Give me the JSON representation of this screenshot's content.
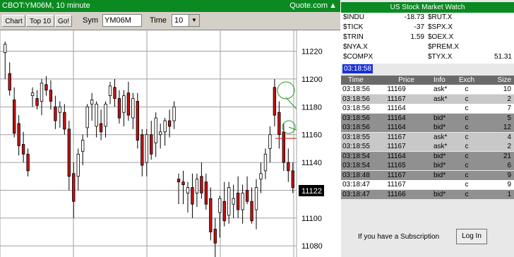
{
  "chart_panel": {
    "title": "CBOT:YM06M, 10 minute",
    "brand": "Quote.com",
    "caret": "▲",
    "toolbar": {
      "chart_btn": "Chart",
      "top10_btn": "Top 10",
      "go_btn": "Go!",
      "sym_label": "Sym",
      "sym_value": "YM06M",
      "time_label": "Time",
      "time_value": "10"
    },
    "y_ticks": [
      "11220",
      "11200",
      "11180",
      "11160",
      "11140",
      "11122",
      "11100",
      "11080"
    ],
    "last_price": "11122"
  },
  "chart_data": {
    "type": "candlestick",
    "y_axis": {
      "min": 11072,
      "max": 11235,
      "ticks": [
        11220,
        11200,
        11180,
        11160,
        11140,
        11120,
        11100,
        11080
      ]
    },
    "grid": true,
    "last_price_marker": 11122,
    "colors": {
      "up": "#ffffff",
      "down": "#c81010",
      "grid": "#a0a0a0"
    },
    "candles": [
      [
        11219,
        11227,
        11200,
        11225
      ],
      [
        11204,
        11212,
        11188,
        11192
      ],
      [
        11185,
        11194,
        11158,
        11161
      ],
      [
        11168,
        11174,
        11145,
        11152
      ],
      [
        11153,
        11162,
        11140,
        11146
      ],
      [
        11146,
        11150,
        11130,
        11134
      ],
      [
        11188,
        11194,
        11180,
        11190
      ],
      [
        11186,
        11192,
        11178,
        11181
      ],
      [
        11184,
        11200,
        11174,
        11197
      ],
      [
        11196,
        11202,
        11188,
        11192
      ],
      [
        11192,
        11199,
        11178,
        11184
      ],
      [
        11180,
        11188,
        11164,
        11170
      ],
      [
        11176,
        11184,
        11165,
        11180
      ],
      [
        11176,
        11182,
        11160,
        11164
      ],
      [
        11164,
        11170,
        11120,
        11130
      ],
      [
        11132,
        11140,
        11100,
        11112
      ],
      [
        11130,
        11150,
        11120,
        11146
      ],
      [
        11148,
        11160,
        11138,
        11156
      ],
      [
        11165,
        11182,
        11158,
        11180
      ],
      [
        11182,
        11190,
        11170,
        11185
      ],
      [
        11166,
        11184,
        11158,
        11182
      ],
      [
        11168,
        11178,
        11156,
        11162
      ],
      [
        11166,
        11184,
        11158,
        11182
      ],
      [
        11188,
        11198,
        11182,
        11195
      ],
      [
        11194,
        11200,
        11180,
        11186
      ],
      [
        11186,
        11192,
        11168,
        11172
      ],
      [
        11176,
        11192,
        11166,
        11188
      ],
      [
        11190,
        11198,
        11170,
        11174
      ],
      [
        11172,
        11190,
        11164,
        11186
      ],
      [
        11184,
        11190,
        11150,
        11156
      ],
      [
        11160,
        11164,
        11130,
        11138
      ],
      [
        11140,
        11164,
        11130,
        11160
      ],
      [
        11160,
        11170,
        11142,
        11146
      ],
      [
        11154,
        11176,
        11144,
        11172
      ],
      [
        11160,
        11168,
        11150,
        11162
      ],
      [
        11162,
        11172,
        11152,
        11170
      ],
      [
        11170,
        11178,
        11158,
        11166
      ],
      [
        11170,
        11184,
        11164,
        11180
      ],
      [
        11128,
        11132,
        11110,
        11126
      ],
      [
        11126,
        11134,
        11110,
        11124
      ],
      [
        11118,
        11126,
        11104,
        11122
      ],
      [
        11122,
        11132,
        11100,
        11110
      ],
      [
        11118,
        11132,
        11108,
        11128
      ],
      [
        11130,
        11140,
        11114,
        11118
      ],
      [
        11126,
        11132,
        11106,
        11110
      ],
      [
        11114,
        11122,
        11084,
        11090
      ],
      [
        11092,
        11100,
        11072,
        11082
      ],
      [
        11104,
        11116,
        11086,
        11114
      ],
      [
        11112,
        11126,
        11094,
        11098
      ],
      [
        11102,
        11126,
        11096,
        11122
      ],
      [
        11110,
        11124,
        11100,
        11114
      ],
      [
        11118,
        11130,
        11100,
        11106
      ],
      [
        11106,
        11124,
        11096,
        11118
      ],
      [
        11120,
        11130,
        11110,
        11112
      ],
      [
        11112,
        11122,
        11096,
        11098
      ],
      [
        11106,
        11128,
        11092,
        11122
      ],
      [
        11128,
        11140,
        11118,
        11132
      ],
      [
        11134,
        11150,
        11128,
        11146
      ],
      [
        11150,
        11166,
        11140,
        11160
      ],
      [
        11194,
        11200,
        11166,
        11174
      ],
      [
        11176,
        11184,
        11150,
        11160
      ],
      [
        11162,
        11168,
        11134,
        11140
      ],
      [
        11140,
        11150,
        11126,
        11134
      ],
      [
        11134,
        11140,
        11118,
        11122
      ]
    ]
  },
  "watch_panel": {
    "title": "US Stock Market Watch",
    "indices": [
      {
        "name": "$INDU",
        "value": "-18.73",
        "name2": "$RUT.X",
        "value2": ""
      },
      {
        "name": "$TICK",
        "value": "-37",
        "name2": "$SPX.X",
        "value2": ""
      },
      {
        "name": "$TRIN",
        "value": "1.59",
        "name2": "$OEX.X",
        "value2": ""
      },
      {
        "name": "$NYA.X",
        "value": "",
        "name2": "$PREM.X",
        "value2": ""
      },
      {
        "name": "$COMPX",
        "value": "",
        "name2": "$TYX.X",
        "value2": "51.31"
      }
    ],
    "clock": "03:18:58",
    "trades_header": {
      "time": "Time",
      "price": "Price",
      "info": "Info",
      "exch": "Exch",
      "size": "Size"
    },
    "trades": [
      {
        "time": "03:18:56",
        "price": "11169",
        "info": "ask*",
        "exch": "c",
        "size": "10"
      },
      {
        "time": "03:18:56",
        "price": "11167",
        "info": "ask*",
        "exch": "c",
        "size": "2"
      },
      {
        "time": "03:18:56",
        "price": "11164",
        "info": "",
        "exch": "c",
        "size": "7"
      },
      {
        "time": "03:18:56",
        "price": "11164",
        "info": "bid*",
        "exch": "c",
        "size": "5"
      },
      {
        "time": "03:18:56",
        "price": "11164",
        "info": "bid*",
        "exch": "c",
        "size": "12"
      },
      {
        "time": "03:18:55",
        "price": "11167",
        "info": "ask*",
        "exch": "c",
        "size": "4"
      },
      {
        "time": "03:18:55",
        "price": "11167",
        "info": "ask*",
        "exch": "c",
        "size": "2"
      },
      {
        "time": "03:18:54",
        "price": "11164",
        "info": "bid*",
        "exch": "c",
        "size": "21"
      },
      {
        "time": "03:18:54",
        "price": "11165",
        "info": "bid*",
        "exch": "c",
        "size": "6"
      },
      {
        "time": "03:18:48",
        "price": "11167",
        "info": "bid*",
        "exch": "c",
        "size": "9"
      },
      {
        "time": "03:18:47",
        "price": "11167",
        "info": "",
        "exch": "c",
        "size": "9"
      },
      {
        "time": "03:18:47",
        "price": "11166",
        "info": "bid*",
        "exch": "c",
        "size": "1"
      }
    ],
    "row_colors": [
      "#ffffff",
      "#c8c8c8",
      "#ffffff",
      "#909090",
      "#909090",
      "#c8c8c8",
      "#c8c8c8",
      "#909090",
      "#909090",
      "#909090",
      "#ffffff",
      "#909090"
    ],
    "subscription_text": "If you have a Subscription",
    "login_label": "Log In"
  }
}
